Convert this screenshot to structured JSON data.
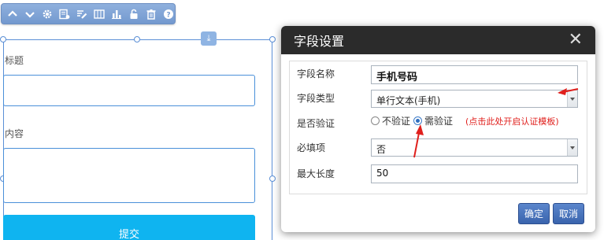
{
  "toolbar": {
    "buttons": [
      "move-up-icon",
      "move-down-icon",
      "settings-icon",
      "field-settings-icon",
      "edit-icon",
      "columns-icon",
      "bar-chart-icon",
      "unlock-icon",
      "delete-icon",
      "help-icon"
    ]
  },
  "form": {
    "fields": [
      {
        "label": "标题"
      },
      {
        "label": "内容"
      }
    ],
    "submit_label": "提交"
  },
  "dialog": {
    "title": "字段设置",
    "rows": {
      "field_name": {
        "label": "字段名称",
        "value": "手机号码"
      },
      "field_type": {
        "label": "字段类型",
        "value": "单行文本(手机)"
      },
      "validation": {
        "label": "是否验证",
        "options": [
          "不验证",
          "需验证"
        ],
        "selected": "需验证",
        "hint": "(点击此处开启认证模板)"
      },
      "required": {
        "label": "必填项",
        "value": "否"
      },
      "max_length": {
        "label": "最大长度",
        "value": "50"
      }
    },
    "buttons": {
      "confirm": "确定",
      "cancel": "取消"
    }
  },
  "colors": {
    "accent": "#3a64ad",
    "header": "#2b2b2b",
    "hint": "#e0201d",
    "submit": "#0fb4f0"
  }
}
